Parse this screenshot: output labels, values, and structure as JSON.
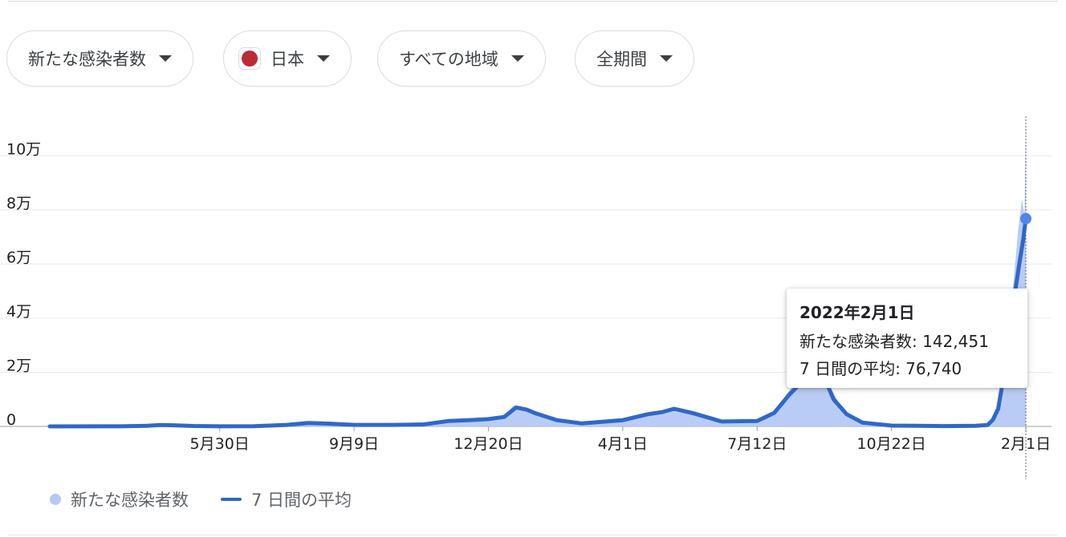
{
  "filters": {
    "metric": {
      "label": "新たな感染者数"
    },
    "country": {
      "label": "日本",
      "flag_color": "#bc2a36"
    },
    "region": {
      "label": "すべての地域"
    },
    "period": {
      "label": "全期間"
    }
  },
  "chart_data": {
    "type": "area",
    "title": "",
    "xlabel": "",
    "ylabel": "",
    "ylim": [
      0,
      115000
    ],
    "y_ticks": [
      {
        "value": 0,
        "label": "0"
      },
      {
        "value": 20000,
        "label": "2万"
      },
      {
        "value": 40000,
        "label": "4万"
      },
      {
        "value": 60000,
        "label": "6万"
      },
      {
        "value": 80000,
        "label": "8万"
      },
      {
        "value": 100000,
        "label": "10万"
      }
    ],
    "x_domain": [
      "2020-01-22",
      "2022-02-01"
    ],
    "x_ticks": [
      {
        "date": "2020-05-30",
        "label": "5月30日"
      },
      {
        "date": "2020-09-09",
        "label": "9月9日"
      },
      {
        "date": "2020-12-20",
        "label": "12月20日"
      },
      {
        "date": "2021-04-01",
        "label": "4月1日"
      },
      {
        "date": "2021-07-12",
        "label": "7月12日"
      },
      {
        "date": "2021-10-22",
        "label": "10月22日"
      },
      {
        "date": "2022-02-01",
        "label": "2月1日"
      }
    ],
    "grid": true,
    "legend_position": "bottom-left",
    "series": [
      {
        "name": "新たな感染者数",
        "kind": "area",
        "color": "#b5c9f4",
        "points": [
          [
            "2020-01-22",
            0
          ],
          [
            "2020-03-15",
            40
          ],
          [
            "2020-04-05",
            350
          ],
          [
            "2020-04-12",
            600
          ],
          [
            "2020-04-20",
            480
          ],
          [
            "2020-05-05",
            150
          ],
          [
            "2020-05-30",
            40
          ],
          [
            "2020-06-25",
            90
          ],
          [
            "2020-07-20",
            620
          ],
          [
            "2020-08-05",
            1400
          ],
          [
            "2020-08-20",
            1150
          ],
          [
            "2020-09-09",
            550
          ],
          [
            "2020-10-10",
            600
          ],
          [
            "2020-11-01",
            800
          ],
          [
            "2020-11-20",
            2200
          ],
          [
            "2020-12-05",
            2500
          ],
          [
            "2020-12-20",
            2900
          ],
          [
            "2021-01-01",
            3600
          ],
          [
            "2021-01-08",
            7800
          ],
          [
            "2021-01-14",
            6800
          ],
          [
            "2021-01-25",
            4500
          ],
          [
            "2021-02-10",
            2000
          ],
          [
            "2021-03-01",
            1000
          ],
          [
            "2021-04-01",
            2400
          ],
          [
            "2021-04-20",
            4800
          ],
          [
            "2021-05-01",
            5500
          ],
          [
            "2021-05-10",
            7200
          ],
          [
            "2021-05-25",
            4800
          ],
          [
            "2021-06-15",
            1800
          ],
          [
            "2021-07-12",
            2200
          ],
          [
            "2021-07-25",
            5500
          ],
          [
            "2021-08-05",
            13000
          ],
          [
            "2021-08-15",
            19000
          ],
          [
            "2021-08-20",
            25900
          ],
          [
            "2021-08-26",
            24500
          ],
          [
            "2021-09-05",
            15000
          ],
          [
            "2021-09-15",
            6000
          ],
          [
            "2021-09-30",
            1500
          ],
          [
            "2021-10-22",
            300
          ],
          [
            "2021-12-01",
            110
          ],
          [
            "2021-12-25",
            250
          ],
          [
            "2022-01-02",
            600
          ],
          [
            "2022-01-06",
            3000
          ],
          [
            "2022-01-10",
            7000
          ],
          [
            "2022-01-14",
            18000
          ],
          [
            "2022-01-18",
            32000
          ],
          [
            "2022-01-22",
            50000
          ],
          [
            "2022-01-26",
            72000
          ],
          [
            "2022-01-29",
            84000
          ],
          [
            "2022-01-31",
            78000
          ],
          [
            "2022-02-01",
            142451
          ]
        ]
      },
      {
        "name": "7 日間の平均",
        "kind": "line",
        "color": "#2f68c9",
        "points": [
          [
            "2020-01-22",
            0
          ],
          [
            "2020-03-15",
            30
          ],
          [
            "2020-04-05",
            250
          ],
          [
            "2020-04-15",
            500
          ],
          [
            "2020-04-25",
            420
          ],
          [
            "2020-05-10",
            150
          ],
          [
            "2020-05-30",
            40
          ],
          [
            "2020-06-25",
            100
          ],
          [
            "2020-07-20",
            550
          ],
          [
            "2020-08-05",
            1250
          ],
          [
            "2020-08-20",
            1050
          ],
          [
            "2020-09-09",
            550
          ],
          [
            "2020-10-10",
            550
          ],
          [
            "2020-11-01",
            750
          ],
          [
            "2020-11-20",
            2000
          ],
          [
            "2020-12-05",
            2300
          ],
          [
            "2020-12-20",
            2700
          ],
          [
            "2021-01-01",
            3500
          ],
          [
            "2021-01-10",
            7000
          ],
          [
            "2021-01-18",
            6200
          ],
          [
            "2021-01-25",
            4800
          ],
          [
            "2021-02-10",
            2300
          ],
          [
            "2021-03-01",
            1100
          ],
          [
            "2021-04-01",
            2300
          ],
          [
            "2021-04-20",
            4500
          ],
          [
            "2021-05-01",
            5300
          ],
          [
            "2021-05-10",
            6500
          ],
          [
            "2021-05-25",
            4800
          ],
          [
            "2021-06-15",
            1800
          ],
          [
            "2021-07-12",
            2000
          ],
          [
            "2021-07-25",
            5000
          ],
          [
            "2021-08-05",
            11500
          ],
          [
            "2021-08-15",
            16500
          ],
          [
            "2021-08-25",
            23000
          ],
          [
            "2021-09-01",
            18000
          ],
          [
            "2021-09-08",
            10000
          ],
          [
            "2021-09-18",
            4500
          ],
          [
            "2021-09-30",
            1400
          ],
          [
            "2021-10-22",
            300
          ],
          [
            "2021-12-01",
            120
          ],
          [
            "2021-12-25",
            250
          ],
          [
            "2022-01-03",
            500
          ],
          [
            "2022-01-07",
            2500
          ],
          [
            "2022-01-11",
            6500
          ],
          [
            "2022-01-15",
            18000
          ],
          [
            "2022-01-19",
            33000
          ],
          [
            "2022-01-23",
            47000
          ],
          [
            "2022-01-27",
            60000
          ],
          [
            "2022-01-30",
            69000
          ],
          [
            "2022-02-01",
            76740
          ]
        ]
      }
    ],
    "hover": {
      "date": "2022-02-01",
      "title": "2022年2月1日",
      "rows": [
        {
          "label": "新たな感染者数: 142,451",
          "value": 142451
        },
        {
          "label": "7 日間の平均: 76,740",
          "value": 76740
        }
      ]
    }
  },
  "legend": [
    {
      "label": "新たな感染者数",
      "color": "#b5c9f4"
    },
    {
      "label": "7 日間の平均",
      "color": "#2f68c9"
    }
  ]
}
